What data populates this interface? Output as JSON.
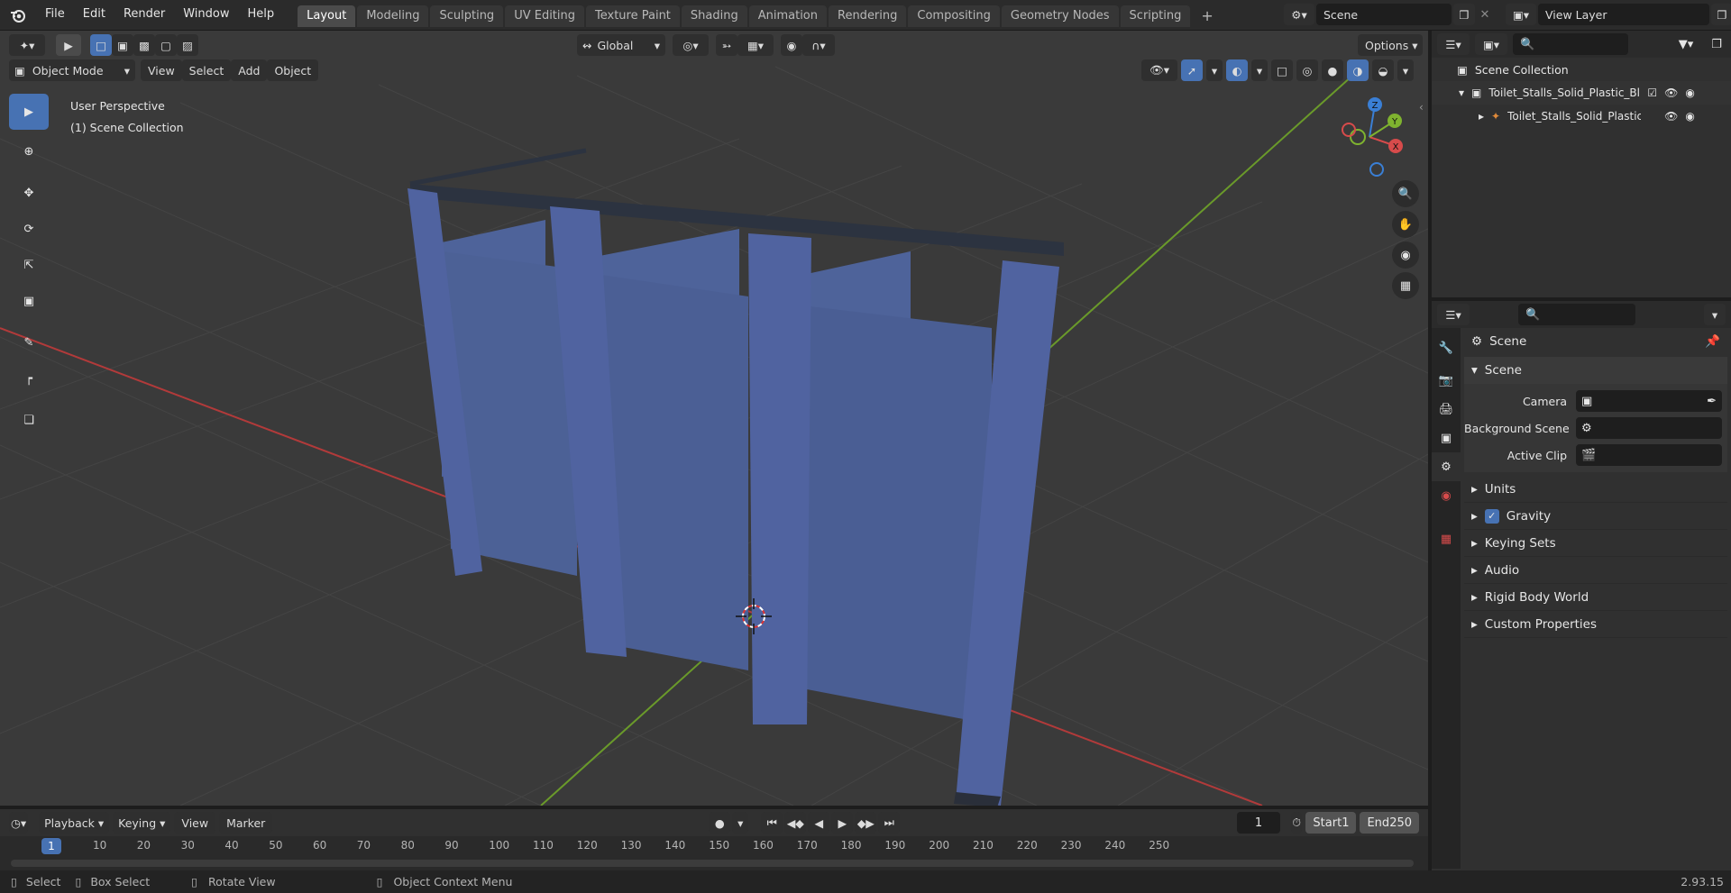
{
  "topbar": {
    "menus": [
      "File",
      "Edit",
      "Render",
      "Window",
      "Help"
    ],
    "workspaces": [
      "Layout",
      "Modeling",
      "Sculpting",
      "UV Editing",
      "Texture Paint",
      "Shading",
      "Animation",
      "Rendering",
      "Compositing",
      "Geometry Nodes",
      "Scripting"
    ],
    "active_workspace": "Layout",
    "add_tab": "+",
    "scene_name": "Scene",
    "view_layer": "View Layer"
  },
  "viewport": {
    "transform_orientation": "Global",
    "options_label": "Options",
    "mode": "Object Mode",
    "menus": [
      "View",
      "Select",
      "Add",
      "Object"
    ],
    "overlay_text": [
      "User Perspective",
      "(1) Scene Collection"
    ],
    "gizmo_axes": {
      "x": "X",
      "y": "Y",
      "z": "Z"
    }
  },
  "outliner": {
    "root": "Scene Collection",
    "items": [
      {
        "label": "Toilet_Stalls_Solid_Plastic_Blue",
        "type": "collection"
      },
      {
        "label": "Toilet_Stalls_Solid_Plastic",
        "type": "object"
      }
    ]
  },
  "properties": {
    "context": "Scene",
    "panel_title": "Scene",
    "fields": [
      {
        "label": "Camera",
        "value": ""
      },
      {
        "label": "Background Scene",
        "value": ""
      },
      {
        "label": "Active Clip",
        "value": ""
      }
    ],
    "subpanels": [
      "Units",
      "Gravity",
      "Keying Sets",
      "Audio",
      "Rigid Body World",
      "Custom Properties"
    ],
    "gravity_checked": true
  },
  "timeline": {
    "menus": [
      "Playback",
      "Keying",
      "View",
      "Marker"
    ],
    "current_frame": "1",
    "start_label": "Start",
    "start": "1",
    "end_label": "End",
    "end": "250",
    "ruler": [
      "1",
      "10",
      "20",
      "30",
      "40",
      "50",
      "60",
      "70",
      "80",
      "90",
      "100",
      "110",
      "120",
      "130",
      "140",
      "150",
      "160",
      "170",
      "180",
      "190",
      "200",
      "210",
      "220",
      "230",
      "240",
      "250"
    ]
  },
  "statusbar": {
    "items": [
      "Select",
      "Box Select",
      "Rotate View",
      "Object Context Menu"
    ],
    "version": "2.93.15"
  },
  "colors": {
    "accent": "#4772b3",
    "stall": "#4a5f96",
    "x_axis": "#d74b4b",
    "y_axis": "#7fb32f",
    "z_axis": "#3a7fd5"
  }
}
